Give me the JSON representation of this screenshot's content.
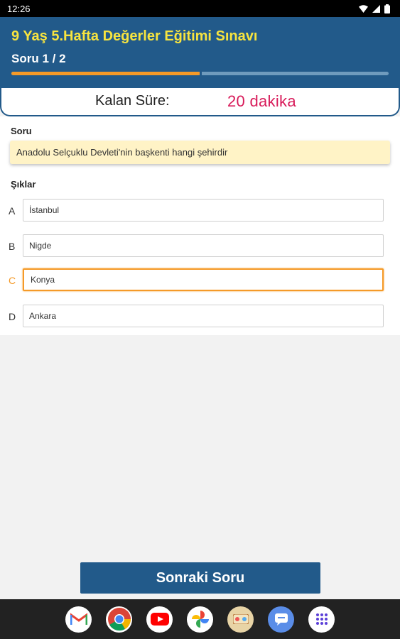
{
  "status_bar": {
    "time": "12:26"
  },
  "header": {
    "title": "9 Yaş 5.Hafta Değerler Eğitimi Sınavı",
    "question_counter": "Soru 1 / 2",
    "progress": {
      "current": 1,
      "total": 2
    }
  },
  "timer": {
    "label": "Kalan Süre:",
    "value": "20 dakika"
  },
  "question": {
    "section_label": "Soru",
    "text": "Anadolu Selçuklu Devleti'nin başkenti hangi şehirdir"
  },
  "options": {
    "section_label": "Şıklar",
    "items": [
      {
        "letter": "A",
        "value": "İstanbul",
        "selected": false
      },
      {
        "letter": "B",
        "value": "Nigde",
        "selected": false
      },
      {
        "letter": "C",
        "value": "Konya",
        "selected": true
      },
      {
        "letter": "D",
        "value": "Ankara",
        "selected": false
      }
    ]
  },
  "next_button": {
    "label": "Sonraki Soru"
  },
  "colors": {
    "header_bg": "#225a8a",
    "title": "#f7e43f",
    "accent_orange": "#f59a28",
    "timer_value": "#d81b5a",
    "question_bg": "#fff3c6"
  },
  "nav_apps": [
    "gmail-icon",
    "chrome-icon",
    "youtube-icon",
    "photos-icon",
    "game-app-icon",
    "messages-icon",
    "app-drawer-icon"
  ]
}
